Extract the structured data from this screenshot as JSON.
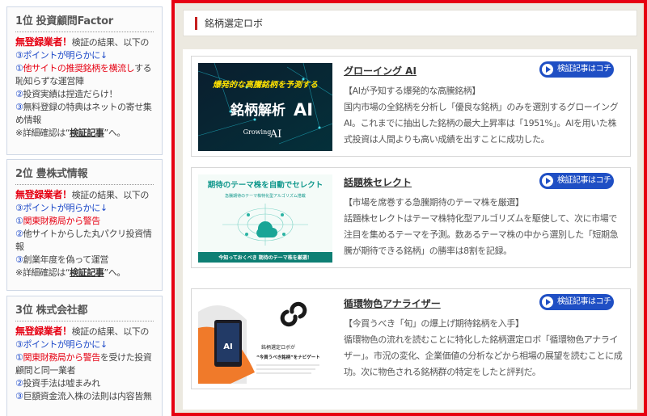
{
  "sidebar": {
    "ranks": [
      {
        "title": "1位 投資顧問Factor",
        "warn": "無登録業者！",
        "intro_a": "検証の結果、以下の",
        "intro_b": "③ポイントが明らかに",
        "intro_arrow": "↓",
        "points": [
          {
            "num": "①",
            "text": "他サイトの推奨銘柄を横流し",
            "cont": "する恥知らずな運営陣",
            "style": "red"
          },
          {
            "num": "②",
            "text": "投資実績は捏造だらけ！",
            "cont": "",
            "style": "plain"
          },
          {
            "num": "③",
            "text": "無料登録の特典はネットの寄せ集め情報",
            "cont": "",
            "style": "plain"
          }
        ],
        "note_a": "※詳細確認は“",
        "note_link": "検証記事",
        "note_b": "”へ。"
      },
      {
        "title": "2位 豊株式情報",
        "warn": "無登録業者！",
        "intro_a": "検証の結果、以下の",
        "intro_b": "③ポイントが明らかに",
        "intro_arrow": "↓",
        "points": [
          {
            "num": "①",
            "text": "関東財務局から警告",
            "cont": "",
            "style": "red"
          },
          {
            "num": "②",
            "text": "他サイトからした丸パクリ投資情報",
            "cont": "",
            "style": "plain"
          },
          {
            "num": "③",
            "text": "創業年度を偽って運営",
            "cont": "",
            "style": "plain"
          }
        ],
        "note_a": "※詳細確認は“",
        "note_link": "検証記事",
        "note_b": "”へ。"
      },
      {
        "title": "3位 株式会社都",
        "warn": "無登録業者！",
        "intro_a": "検証の結果、以下の",
        "intro_b": "③ポイントが明らかに",
        "intro_arrow": "↓",
        "points": [
          {
            "num": "①",
            "text": "関東財務局から警告",
            "cont": "を受けた投資顧問と同一業者",
            "style": "red"
          },
          {
            "num": "②",
            "text": "投資手法は嘘まみれ",
            "cont": "",
            "style": "plain"
          },
          {
            "num": "③",
            "text": "巨額資金流入株の法則は内容皆無",
            "cont": "",
            "style": "plain"
          }
        ]
      }
    ]
  },
  "main": {
    "section_title": "銘柄選定ロボ",
    "verify_label": "検証記事はコチラ",
    "cards": [
      {
        "title": "グローイング AI",
        "tagline": "【AIが予知する爆発的な高騰銘柄】",
        "desc": "国内市場の全銘柄を分析し「優良な銘柄」のみを選別するグローイングAI。これまでに抽出した銘柄の最大上昇率は「1951%」。AIを用いた株式投資は人間よりも高い成績を出すことに成功した。",
        "img_headline": "爆発的な高騰銘柄を予測する",
        "img_main": "銘柄解析",
        "img_ai": "AI",
        "img_brand": "Growing",
        "img_brand_ai": "AI"
      },
      {
        "title": "話題株セレクト",
        "tagline": "【市場を席巻する急騰期待のテーマ株を厳選】",
        "desc": "話題株セレクトはテーマ株特化型アルゴリズムを駆使して、次に市場で注目を集めるテーマを予測。数あるテーマ株の中から選別した「短期急騰が期待できる銘柄」の勝率は8割を記録。",
        "img_headline": "期待のテーマ株を自動でセレクト",
        "img_sub": "急騰期待のテーマ株特化型アルゴリズム搭載",
        "img_footer": "今知っておくべき 期待のテーマ株を厳選！"
      },
      {
        "title": "循環物色アナライザー",
        "tagline": "【今買うべき「旬」の爆上げ期待銘柄を入手】",
        "desc": "循環物色の流れを読むことに特化した銘柄選定ロボ「循環物色アナライザー」。市況の変化、企業価値の分析などから相場の展望を読むことに成功。次に物色される銘柄群の特定をしたと評判だ。",
        "img_line1": "銘柄選定ロボが",
        "img_line2": "“今買うべき銘柄”をナビゲート",
        "img_screen": "AI"
      }
    ]
  },
  "colors": {
    "frame_red": "#e60012",
    "accent_blue": "#1f4fc4",
    "link_blue": "#1a47c8"
  }
}
